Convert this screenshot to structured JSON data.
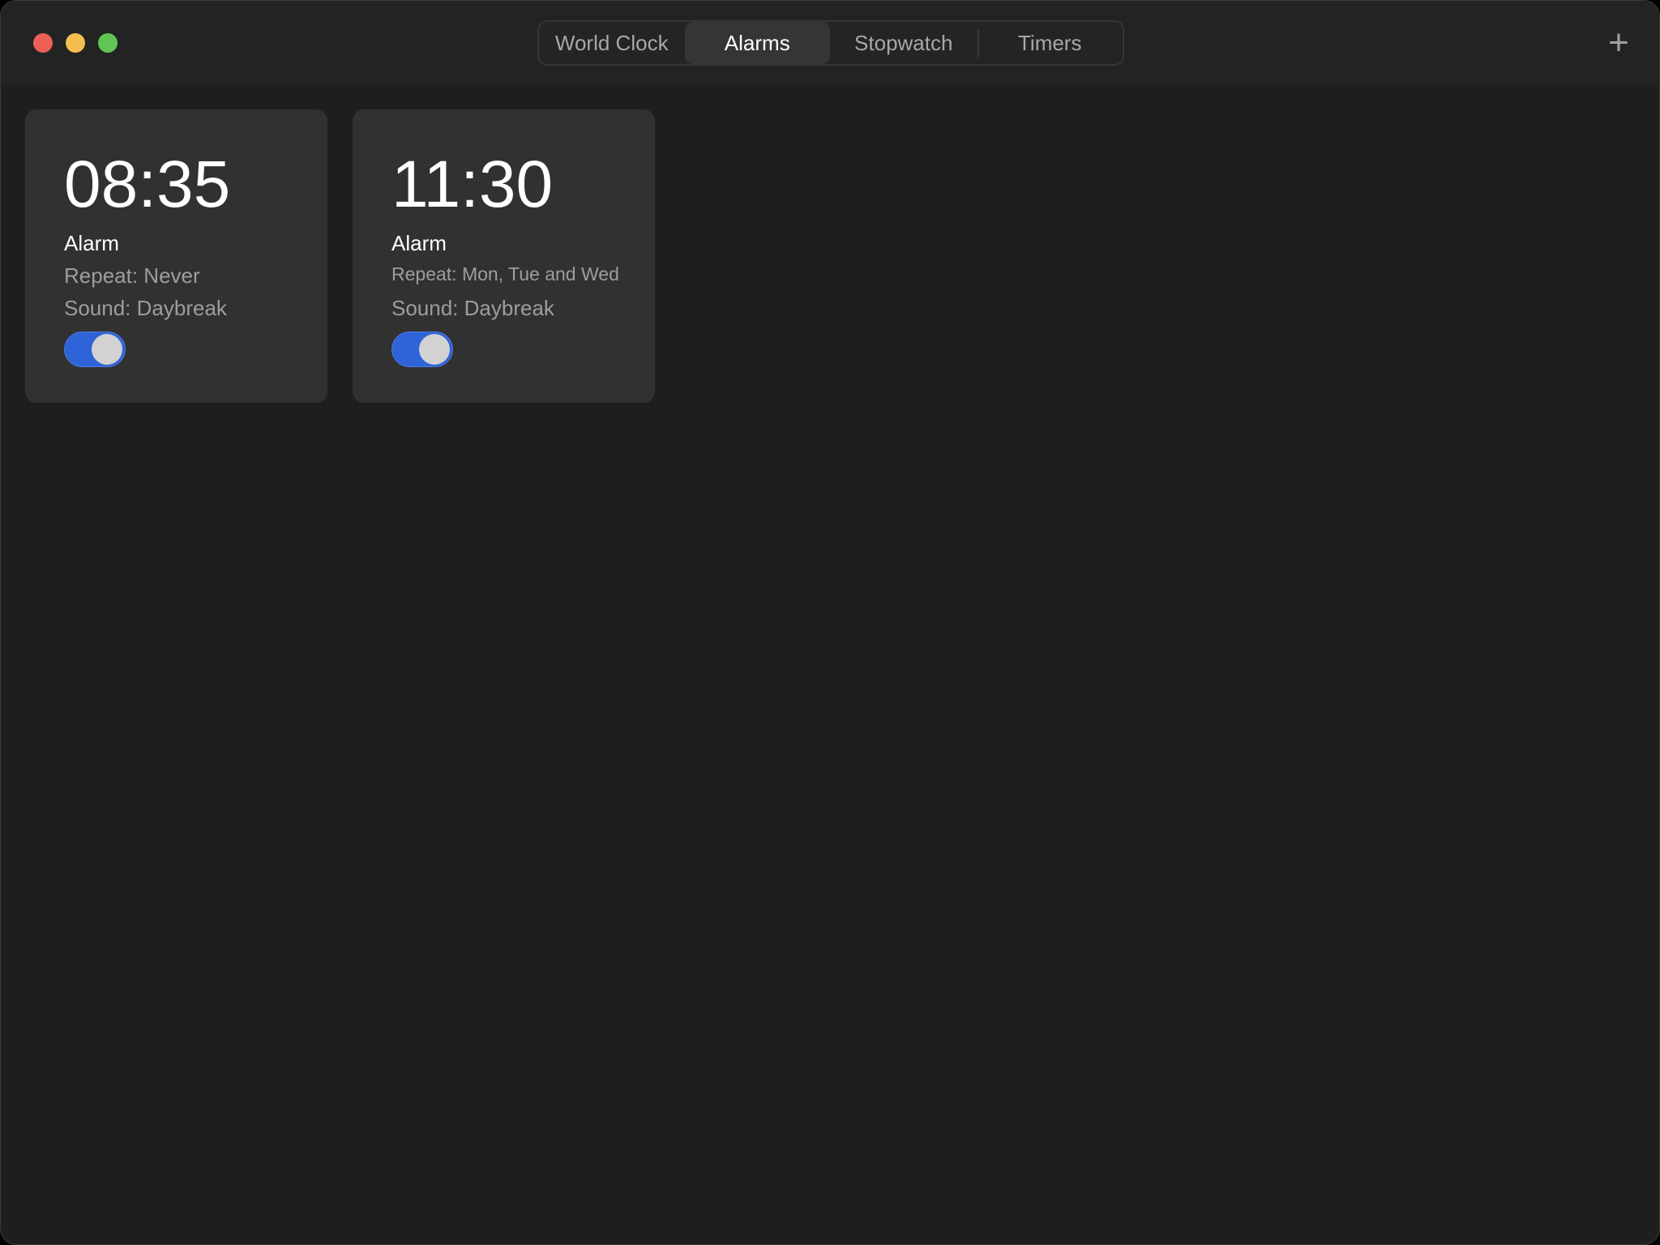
{
  "tabs": [
    {
      "label": "World Clock"
    },
    {
      "label": "Alarms"
    },
    {
      "label": "Stopwatch"
    },
    {
      "label": "Timers"
    }
  ],
  "toolbar": {
    "add_label": "+"
  },
  "alarms": [
    {
      "time": "08:35",
      "label": "Alarm",
      "repeat": "Repeat: Never",
      "sound": "Sound: Daybreak",
      "enabled": true
    },
    {
      "time": "11:30",
      "label": "Alarm",
      "repeat": "Repeat: Mon, Tue and Wed",
      "sound": "Sound: Daybreak",
      "enabled": true
    }
  ],
  "colors": {
    "accent": "#2f63d8",
    "close": "#ec5f57",
    "minimize": "#f4bf4f",
    "maximize": "#61c554"
  }
}
